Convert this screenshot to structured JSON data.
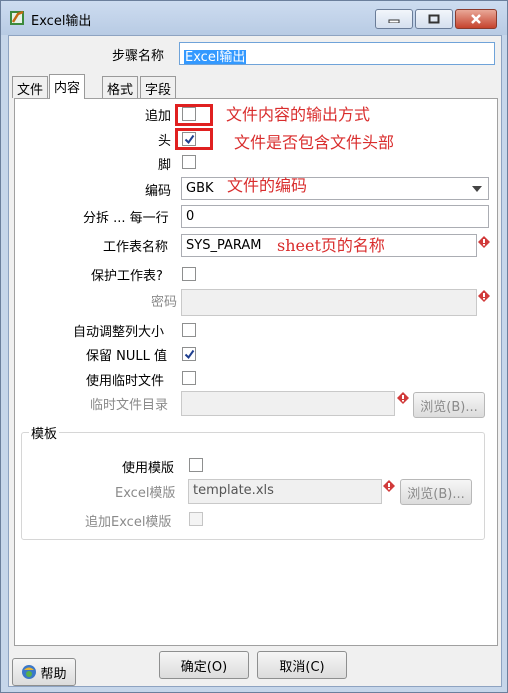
{
  "window": {
    "title": "Excel输出",
    "buttons": {
      "minimize": "minimize",
      "maximize": "maximize",
      "close": "close"
    }
  },
  "step_name": {
    "label": "步骤名称",
    "value": "Excel输出"
  },
  "tabs": [
    {
      "label": "文件",
      "active": false
    },
    {
      "label": "内容",
      "active": true
    },
    {
      "label": "格式",
      "active": false
    },
    {
      "label": "字段",
      "active": false
    }
  ],
  "content": {
    "append": {
      "label": "追加",
      "checked": false
    },
    "header": {
      "label": "头",
      "checked": true
    },
    "footer": {
      "label": "脚",
      "checked": false
    },
    "encoding": {
      "label": "编码",
      "value": "GBK"
    },
    "split_every": {
      "label": "分拆 ... 每一行",
      "value": "0"
    },
    "sheet_name": {
      "label": "工作表名称",
      "value": "SYS_PARAM"
    },
    "protect_sheet": {
      "label": "保护工作表?",
      "checked": false
    },
    "password": {
      "label": "密码",
      "value": ""
    },
    "auto_size": {
      "label": "自动调整列大小",
      "checked": false
    },
    "keep_null": {
      "label": "保留 NULL 值",
      "checked": true
    },
    "use_temp": {
      "label": "使用临时文件",
      "checked": false
    },
    "temp_dir": {
      "label": "临时文件目录",
      "value": "",
      "browse": "浏览(B)..."
    }
  },
  "template": {
    "group_label": "模板",
    "use_template": {
      "label": "使用模版",
      "checked": false
    },
    "excel_template": {
      "label": "Excel模版",
      "value": "template.xls",
      "browse": "浏览(B)..."
    },
    "append_template": {
      "label": "追加Excel模版",
      "checked": false
    }
  },
  "annotations": {
    "append_note": "文件内容的输出方式",
    "header_note": "文件是否包含文件头部",
    "encoding_note": "文件的编码",
    "sheet_note": "sheet页的名称"
  },
  "footer_buttons": {
    "help": "帮助",
    "ok": "确定(O)",
    "cancel": "取消(C)"
  },
  "colors": {
    "annotation": "#d92d2d",
    "checkmark": "#1f3f8f",
    "required_marker": "#d13a3a"
  }
}
